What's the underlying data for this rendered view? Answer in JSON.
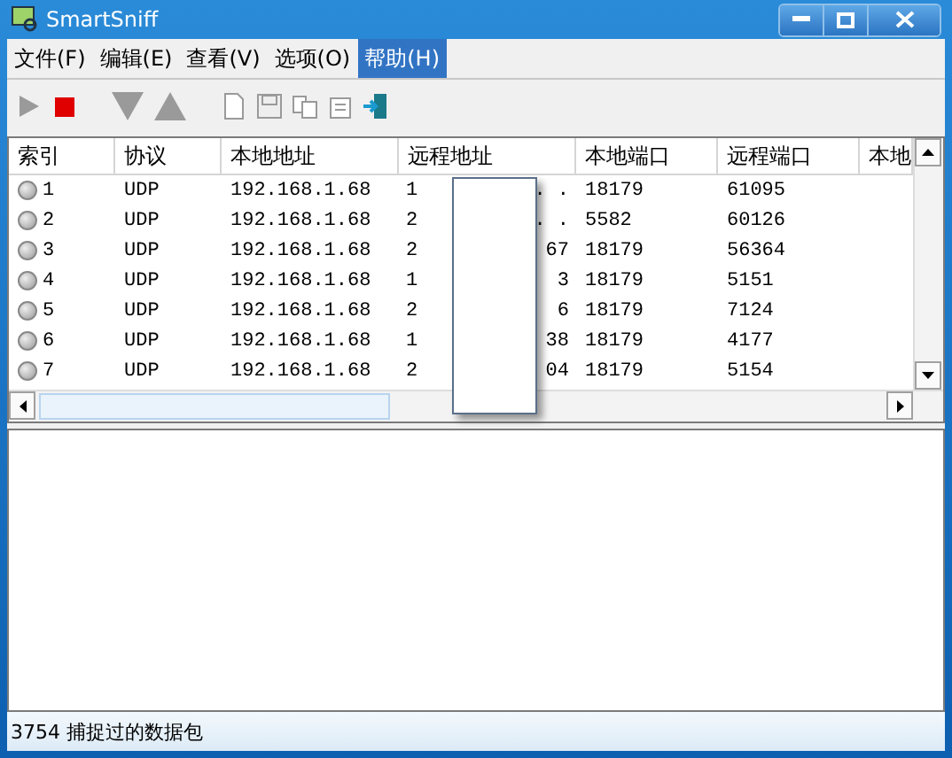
{
  "window": {
    "title": "SmartSniff"
  },
  "menu": [
    {
      "label": "文件(F)",
      "selected": false
    },
    {
      "label": "编辑(E)",
      "selected": false
    },
    {
      "label": "查看(V)",
      "selected": false
    },
    {
      "label": "选项(O)",
      "selected": false
    },
    {
      "label": "帮助(H)",
      "selected": true
    }
  ],
  "toolbar": [
    {
      "kind": "play",
      "disabled": true
    },
    {
      "kind": "stop",
      "disabled": false
    },
    {
      "kind": "down",
      "disabled": true
    },
    {
      "kind": "up",
      "disabled": true
    },
    {
      "kind": "new",
      "disabled": true
    },
    {
      "kind": "save",
      "disabled": true
    },
    {
      "kind": "copy",
      "disabled": true
    },
    {
      "kind": "properties",
      "disabled": true
    },
    {
      "kind": "exit",
      "disabled": false
    }
  ],
  "table": {
    "columns": [
      "索引",
      "协议",
      "本地地址",
      "远程地址",
      "本地端口",
      "远程端口",
      "本地"
    ],
    "rows": [
      {
        "index": "1",
        "protocol": "UDP",
        "local_address": "192.168.1.68",
        "remote_address_start": "1",
        "remote_address_end": ". .",
        "local_port": "18179",
        "remote_port": "61095"
      },
      {
        "index": "2",
        "protocol": "UDP",
        "local_address": "192.168.1.68",
        "remote_address_start": "2",
        "remote_address_end": ". .",
        "local_port": "5582",
        "remote_port": "60126"
      },
      {
        "index": "3",
        "protocol": "UDP",
        "local_address": "192.168.1.68",
        "remote_address_start": "2",
        "remote_address_end": "67",
        "local_port": "18179",
        "remote_port": "56364"
      },
      {
        "index": "4",
        "protocol": "UDP",
        "local_address": "192.168.1.68",
        "remote_address_start": "1",
        "remote_address_end": "3",
        "local_port": "18179",
        "remote_port": "5151"
      },
      {
        "index": "5",
        "protocol": "UDP",
        "local_address": "192.168.1.68",
        "remote_address_start": "2",
        "remote_address_end": "6",
        "local_port": "18179",
        "remote_port": "7124"
      },
      {
        "index": "6",
        "protocol": "UDP",
        "local_address": "192.168.1.68",
        "remote_address_start": "1",
        "remote_address_end": "38",
        "local_port": "18179",
        "remote_port": "4177"
      },
      {
        "index": "7",
        "protocol": "UDP",
        "local_address": "192.168.1.68",
        "remote_address_start": "2",
        "remote_address_end": "04",
        "local_port": "18179",
        "remote_port": "5154"
      }
    ]
  },
  "status_bar": {
    "text": "3754 捕捉过的数据包"
  }
}
